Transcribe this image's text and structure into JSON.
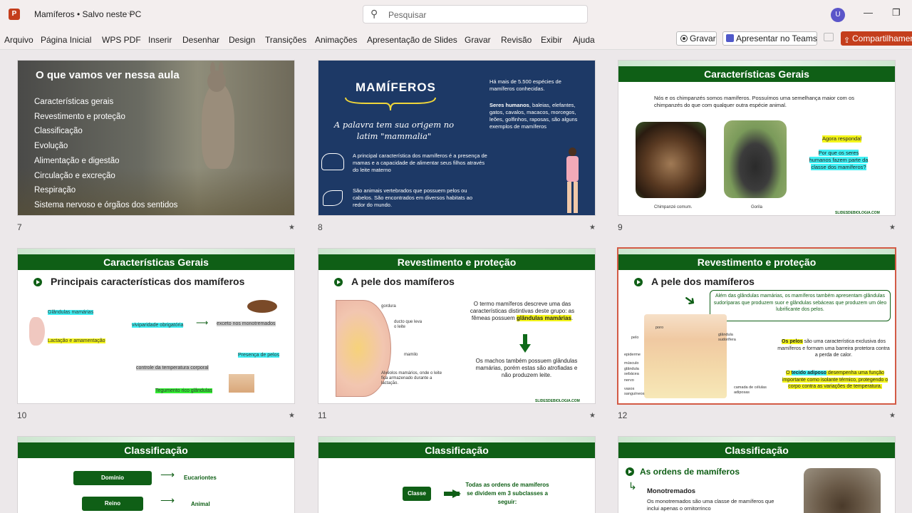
{
  "app": {
    "logo": "P",
    "doc_title": "Mamíferos • Salvo neste PC",
    "search_placeholder": "Pesquisar",
    "user_initial": "U"
  },
  "menu": [
    "Arquivo",
    "Página Inicial",
    "WPS PDF",
    "Inserir",
    "Desenhar",
    "Design",
    "Transições",
    "Animações",
    "Apresentação de Slides",
    "Gravar",
    "Revisão",
    "Exibir",
    "Ajuda"
  ],
  "actions": {
    "record": "Gravar",
    "teams": "Apresentar no Teams",
    "share": "Compartilhamento"
  },
  "slides": {
    "s7": {
      "number": "7",
      "title": "O que vamos ver nessa aula",
      "items": [
        "Características gerais",
        "Revestimento e proteção",
        "Classificação",
        "Evolução",
        "Alimentação e digestão",
        "Circulação e excreção",
        "Respiração",
        "Sistema nervoso e órgãos dos sentidos"
      ]
    },
    "s8": {
      "number": "8",
      "title": "MAMÍFEROS",
      "subtitle": "A palavra tem sua origem no latim \"mammalia\"",
      "t1": "Há mais de 5.500 espécies de mamíferos conhecidas.",
      "t2_bold": "Seres humanos",
      "t2": ", baleias, elefantes, gatos, cavalos, macacos, morcegos, leões, golfinhos, raposas, são alguns exemplos de mamíferos",
      "t3": "A principal característica dos mamíferos é a presença de mamas e a capacidade de alimentar seus filhos através do leite materno",
      "t4": "São animais vertebrados que possuem pelos ou cabelos. São encontrados em diversos habitats ao redor do mundo."
    },
    "s9": {
      "number": "9",
      "header": "Características Gerais",
      "intro": "Nós e os chimpanzés somos mamíferos. Possuímos uma semelhança maior com os chimpanzés do que com qualquer outra espécie animal.",
      "cap1": "Chimpanzé comum.",
      "cap2": "Gorila",
      "q1": "Agora responda!",
      "q2": "Por que os seres humanos fazem parte da classe dos mamíferos?",
      "footer": "SLIDESDEBIOLOGIA.COM"
    },
    "s10": {
      "number": "10",
      "header": "Características Gerais",
      "title": "Principais características dos mamíferos",
      "l1": "Glândulas mamárias",
      "l2": "Lactação e amamentação",
      "l3": "viviparidade obrigatória",
      "l4": "exceto nos monotremados",
      "l5": "Presença de pelos",
      "l6": "controle da temperatura corporal",
      "l7": "Tegumento rico glândulas"
    },
    "s11": {
      "number": "11",
      "header": "Revestimento e proteção",
      "title": "A pele dos mamíferos",
      "lab1": "gordura",
      "lab2": "ducto que leva o leite",
      "lab3": "mamilo",
      "lab4": "Alvéolos mamários,  onde o leite fica armazenado durante a lactação.",
      "p1": "O termo mamíferos descreve uma das características distintivas deste grupo: as fêmeas possuem ",
      "p1_hl": "glândulas mamárias",
      "p2": "Os machos também possuem glândulas mamárias, porém estas são atrofiadas e não produzem leite.",
      "footer": "SLIDESDEBIOLOGIA.COM"
    },
    "s12": {
      "number": "12",
      "header": "Revestimento e proteção",
      "title": "A pele dos mamíferos",
      "box": "Além das glândulas mamárias,  os  mamíferos também apresentam glândulas sudoríparas que produzem suor e glândulas sebáceas que produzem um óleo lubrificante dos pelos.",
      "p1_hl": "Os pelos",
      "p1": " são uma característica exclusiva dos mamíferos e formam uma barreira protetora contra a perda de calor.",
      "p2_pre": "O ",
      "p2_hl": "tecido adiposo",
      "p2": " desempenha uma função importante como isolante térmico, protegendo o corpo contra as variações de temperatura.",
      "labels": [
        "poro",
        "pelo",
        "glândula sudorífera",
        "epiderme",
        "músculo",
        "glândula sebácea",
        "nervo",
        "vasos sanguíneos",
        "camada de células adiposas"
      ]
    },
    "s13": {
      "header": "Classificação",
      "b1": "Domínio",
      "v1": "Eucariontes",
      "b2": "Reino",
      "v2": "Animal"
    },
    "s14": {
      "header": "Classificação",
      "b1": "Classe",
      "t1": "Todas as ordens de mamíferos  se dividem em 3 subclasses a seguir:"
    },
    "s15": {
      "header": "Classificação",
      "title": "As ordens de mamíferos",
      "sub": "Monotremados",
      "t1": "Os monotremados são uma classe de mamíferos que inclui apenas o ornitorrinco"
    }
  },
  "colors": {
    "accent": "#c43e1c",
    "green": "#0f5f16",
    "navy": "#1d3966"
  }
}
